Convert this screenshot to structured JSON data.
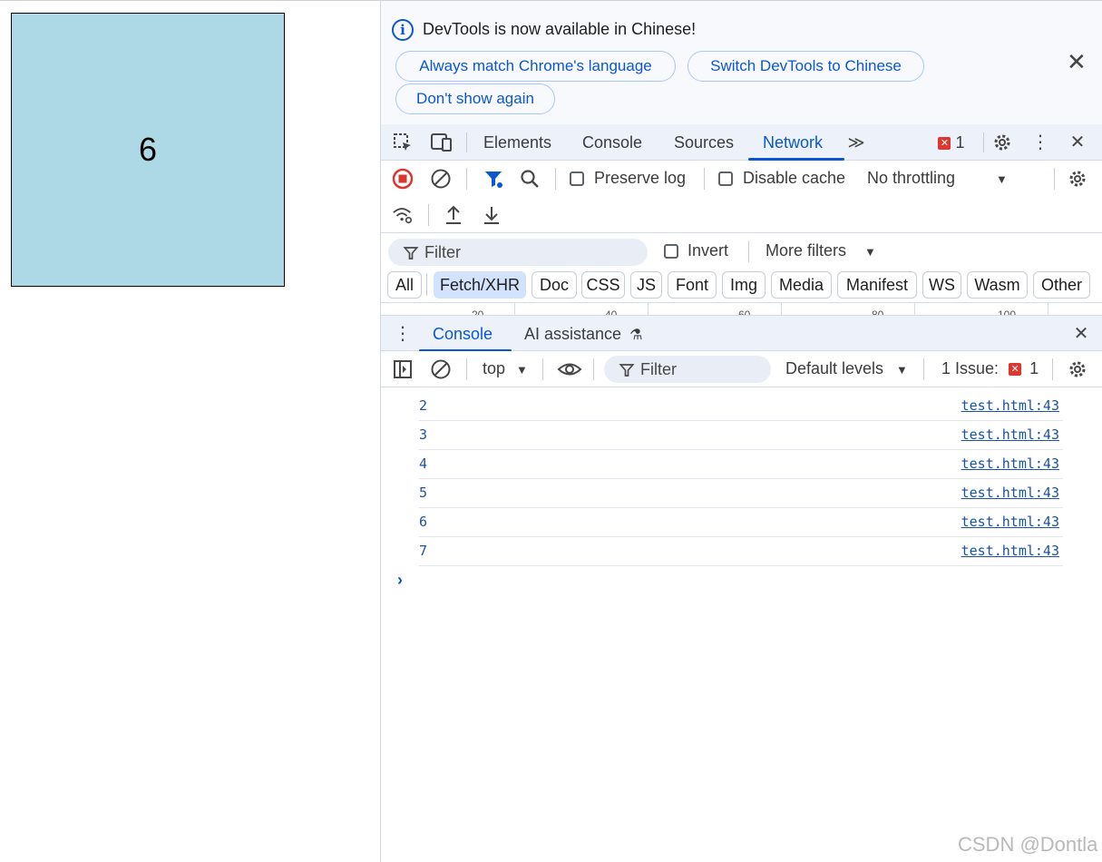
{
  "page": {
    "box_number": "6"
  },
  "infobar": {
    "message": "DevTools is now available in Chinese!",
    "btn_match": "Always match Chrome's language",
    "btn_switch": "Switch DevTools to Chinese",
    "btn_dont_show": "Don't show again"
  },
  "tabs": {
    "elements": "Elements",
    "console": "Console",
    "sources": "Sources",
    "network": "Network",
    "error_count": "1"
  },
  "network_toolbar": {
    "preserve_log": "Preserve log",
    "disable_cache": "Disable cache",
    "throttling": "No throttling"
  },
  "filter": {
    "placeholder": "Filter",
    "invert": "Invert",
    "more_filters": "More filters"
  },
  "type_filters": [
    "All",
    "Fetch/XHR",
    "Doc",
    "CSS",
    "JS",
    "Font",
    "Img",
    "Media",
    "Manifest",
    "WS",
    "Wasm",
    "Other"
  ],
  "type_filter_active": "Fetch/XHR",
  "timeline_labels": [
    "20",
    "40",
    "60",
    "80",
    "100"
  ],
  "drawer": {
    "console_tab": "Console",
    "ai_tab": "AI assistance"
  },
  "console_toolbar": {
    "context": "top",
    "filter_placeholder": "Filter",
    "levels": "Default levels",
    "issues_label": "1 Issue:",
    "issues_count": "1"
  },
  "console_logs": [
    {
      "value": "2",
      "source": "test.html:43"
    },
    {
      "value": "3",
      "source": "test.html:43"
    },
    {
      "value": "4",
      "source": "test.html:43"
    },
    {
      "value": "5",
      "source": "test.html:43"
    },
    {
      "value": "6",
      "source": "test.html:43"
    },
    {
      "value": "7",
      "source": "test.html:43"
    }
  ],
  "watermark": "CSDN @Dontla",
  "colors": {
    "accent": "#0b57d0",
    "box": "#add8e6",
    "error": "#dc362e"
  }
}
